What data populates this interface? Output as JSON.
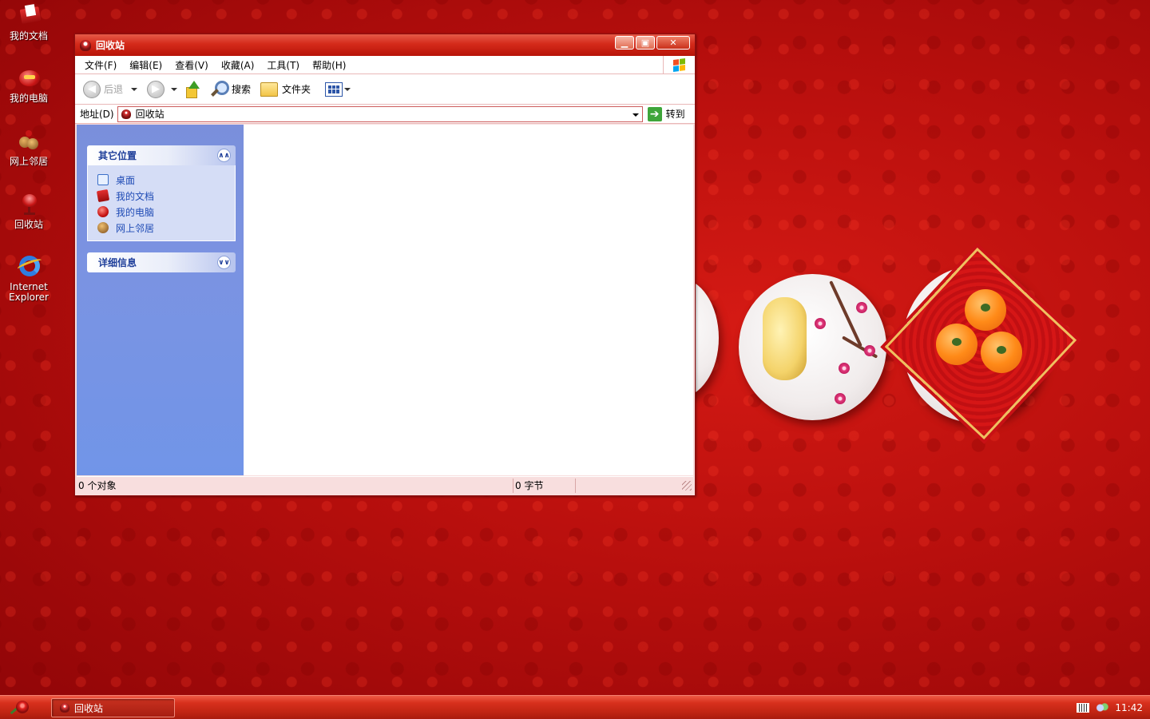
{
  "desktop": {
    "icons": [
      {
        "label": "我的文档",
        "icon": "my-documents-icon"
      },
      {
        "label": "我的电脑",
        "icon": "my-computer-icon"
      },
      {
        "label": "网上邻居",
        "icon": "network-places-icon"
      },
      {
        "label": "回收站",
        "icon": "recycle-bin-icon"
      },
      {
        "label_line1": "Internet",
        "label_line2": "Explorer",
        "icon": "internet-explorer-icon"
      }
    ]
  },
  "window": {
    "title": "回收站",
    "menu": [
      "文件(F)",
      "编辑(E)",
      "查看(V)",
      "收藏(A)",
      "工具(T)",
      "帮助(H)"
    ],
    "toolbar": {
      "back_label": "后退",
      "search_label": "搜索",
      "folders_label": "文件夹"
    },
    "address": {
      "label": "地址(D)",
      "value": "回收站",
      "go_label": "转到"
    },
    "taskpane": {
      "other_places": {
        "title": "其它位置",
        "items": [
          "桌面",
          "我的文档",
          "我的电脑",
          "网上邻居"
        ]
      },
      "details": {
        "title": "详细信息"
      }
    },
    "status": {
      "objects": "0 个对象",
      "size": "0 字节"
    }
  },
  "taskbar": {
    "task_label": "回收站",
    "clock": "11:42"
  },
  "colors": {
    "accent": "#d42a1a",
    "taskpane": "#7b93e2",
    "link": "#1f4bb5"
  }
}
